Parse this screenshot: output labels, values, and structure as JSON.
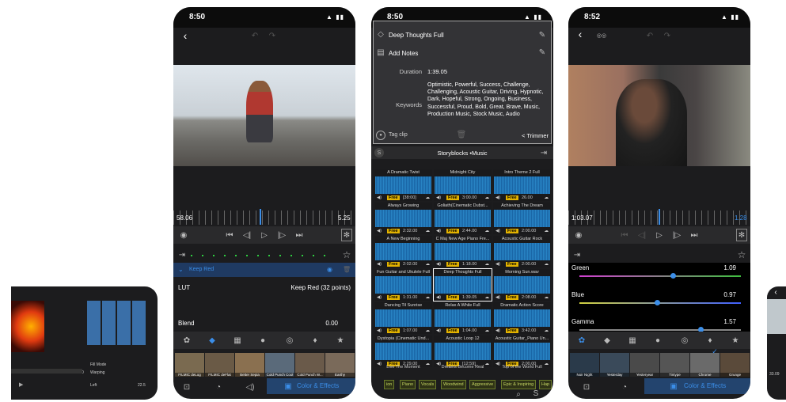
{
  "colors": {
    "accent": "#3b8ee8",
    "free": "#e2b200",
    "tag": "#c7d864"
  },
  "phone1": {
    "caption_items": [
      "Fill Mode",
      "Warping"
    ],
    "left": "Left",
    "value": "22.5",
    "time": "2.00"
  },
  "phone2": {
    "time": "8:50",
    "start": "58.06",
    "end": "5.25",
    "effect": "Keep Red",
    "lut_label": "LUT",
    "lut_value": "Keep Red (32 points)",
    "blend_label": "Blend",
    "blend_value": "0.00",
    "color_effects": "Color & Effects",
    "thumbs": [
      "FILMIC deLog",
      "FILMIC deFlat",
      "Better Sepia",
      "Cold Punch Cool",
      "Cold Punch W...",
      "Earthy"
    ]
  },
  "phone3": {
    "time": "8:50",
    "title": "Deep Thoughts Full",
    "add_notes": "Add Notes",
    "duration_label": "Duration",
    "duration_value": "1:39.05",
    "keywords_label": "Keywords",
    "keywords_value": "Optimistic, Powerful, Success, Challenge, Challenging, Acoustic Guitar, Driving, Hypnotic, Dark, Hopeful, Strong, Ongoing, Business, Successful, Proud, Bold, Great, Brave, Music, Production Music, Stock Music, Audio",
    "tag_clip": "Tag clip",
    "trimmer": "< Trimmer",
    "source": "Storyblocks •Music",
    "grid": [
      {
        "name": "A Dramatic Twist",
        "free": "Free",
        "dur": "[38:00]"
      },
      {
        "name": "Midnight City",
        "free": "Free",
        "dur": "3:00.00"
      },
      {
        "name": "Intro Theme 2 Full",
        "free": "Free",
        "dur": "26.00"
      },
      {
        "name": "Always Growing",
        "free": "Free",
        "dur": "2:32.00"
      },
      {
        "name": "Goliath(Cinematic Dubst...",
        "free": "Free",
        "dur": "2:44.00"
      },
      {
        "name": "Achieving The Dream",
        "free": "Free",
        "dur": "2:00.00"
      },
      {
        "name": "A New Beginning",
        "free": "Free",
        "dur": "2:02.00"
      },
      {
        "name": "C Maj New Age Piano Fre...",
        "free": "Free",
        "dur": "1:18.00"
      },
      {
        "name": "Acoustic Guitar Rock",
        "free": "Free",
        "dur": "2:00.00"
      },
      {
        "name": "Fun Guitar and Ukulele Full",
        "free": "Free",
        "dur": "1:31.00"
      },
      {
        "name": "Deep Thoughts Full",
        "free": "Free",
        "dur": "1:39.05"
      },
      {
        "name": "Morning Sun.wav",
        "free": "Free",
        "dur": "2:08.00"
      },
      {
        "name": "Dancing Til Sunrise",
        "free": "Free",
        "dur": "1:07.00"
      },
      {
        "name": "Relax A While Full",
        "free": "Free",
        "dur": "1:04.00"
      },
      {
        "name": "Dramatic Action Score",
        "free": "Free",
        "dur": "3:42.00"
      },
      {
        "name": "Dystopia (Cinematic Und...",
        "free": "Free",
        "dur": "2:29.00"
      },
      {
        "name": "Acoustic Loop 12",
        "free": "Free",
        "dur": "[12:59]"
      },
      {
        "name": "Acoustic Guitar_Piano Un...",
        "free": "Free",
        "dur": "2:00.00"
      }
    ],
    "bottom_names": [
      "Live The Moment",
      "Dreams Become Real",
      "Top of the World Full"
    ],
    "tags": [
      "ion",
      "Piano",
      "Vocals",
      "Woodwind",
      "Aggressive",
      "Epic & Inspiring",
      "Hap"
    ]
  },
  "phone4": {
    "time": "8:52",
    "start": "1:03.07",
    "end": "1.28",
    "green_label": "Green",
    "green_value": "1.09",
    "blue_label": "Blue",
    "blue_value": "0.97",
    "gamma_label": "Gamma",
    "gamma_value": "1.57",
    "color_effects": "Color & Effects",
    "thumbs": [
      "Noir Night",
      "Yesterday",
      "Yesteryear",
      "Tintype",
      "Chrome",
      "Grunge"
    ]
  },
  "phone5": {
    "time": "33.09"
  }
}
